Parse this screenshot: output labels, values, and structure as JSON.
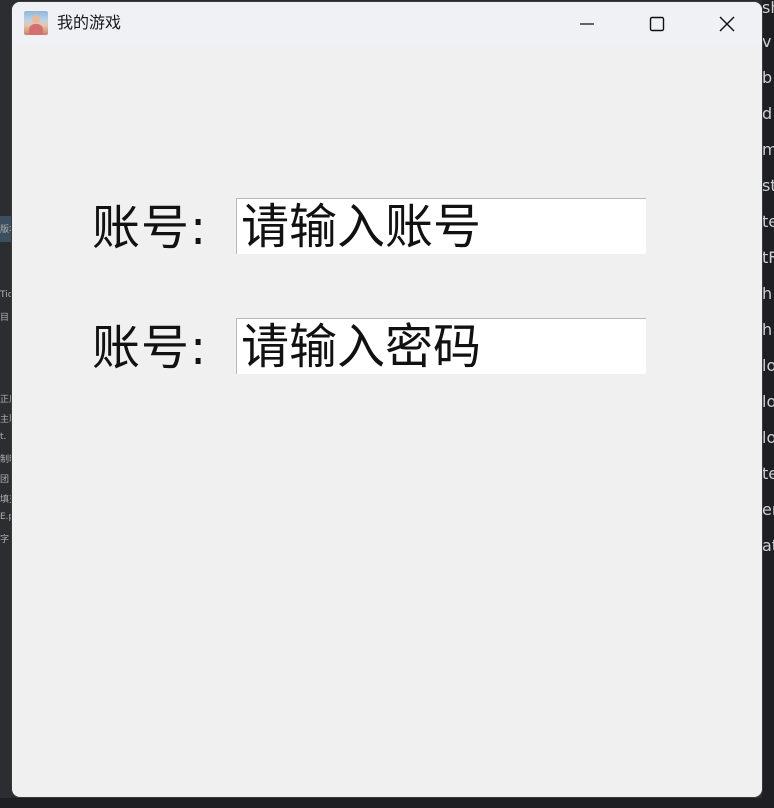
{
  "window": {
    "title": "我的游戏",
    "icon": "app-avatar-icon",
    "controls": [
      "minimize-icon",
      "maximize-icon",
      "close-icon"
    ]
  },
  "form": {
    "account_label": "账号:",
    "account_placeholder": "请输入账号",
    "password_label": "账号:",
    "password_placeholder": "请输入密码"
  },
  "background": {
    "left_fragments": [
      "版本",
      "Tic",
      "目",
      "正后",
      "主联",
      "t.",
      "制明",
      "团",
      "填充",
      "E.p",
      "字"
    ],
    "right_fragments": [
      "sh",
      "v",
      "b",
      "d",
      "m",
      "st",
      "te",
      "tF",
      "h",
      "h",
      "lo",
      "lo",
      "lo",
      "te",
      "er",
      "at"
    ]
  },
  "colors": {
    "window_bg": "#f0f0f0",
    "titlebar_bg": "#eff1f5",
    "field_bg": "#ffffff",
    "text": "#111111"
  }
}
